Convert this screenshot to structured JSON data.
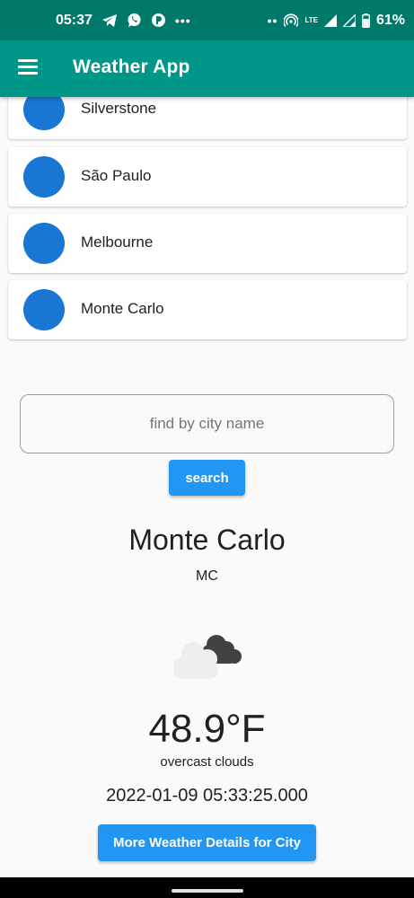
{
  "status_bar": {
    "time": "05:37",
    "left_icons": [
      "telegram-icon",
      "whatsapp-icon",
      "app-icon"
    ],
    "overflow_dots": "•••",
    "right_dots": "••",
    "network_label": "LTE",
    "battery_percent": "61%"
  },
  "app_bar": {
    "title": "Weather App",
    "menu_icon": "hamburger-menu-icon",
    "background": "#009688"
  },
  "cities": [
    {
      "name": "Silverstone"
    },
    {
      "name": "São Paulo"
    },
    {
      "name": "Melbourne"
    },
    {
      "name": "Monte Carlo"
    }
  ],
  "search": {
    "placeholder": "find by city name",
    "value": "",
    "button_label": "search"
  },
  "weather": {
    "city": "Monte Carlo",
    "country": "MC",
    "icon": "overcast-clouds-icon",
    "temperature": "48.9°F",
    "description": "overcast clouds",
    "timestamp": "2022-01-09 05:33:25.000",
    "details_button_label": "More Weather Details for City"
  },
  "colors": {
    "status_bar": "#00796b",
    "accent": "#2196f3",
    "avatar": "#1976d2"
  }
}
